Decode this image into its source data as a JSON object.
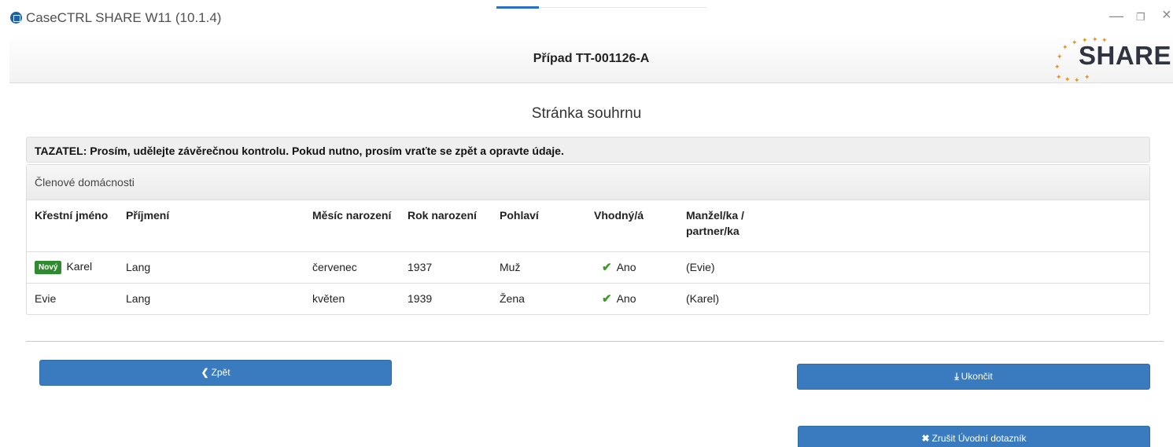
{
  "window": {
    "title": "CaseCTRL SHARE W11 (10.1.4)",
    "minimize_glyph": "—",
    "restore_glyph": "❐",
    "close_glyph": "×"
  },
  "header": {
    "case_title": "Případ TT-001126-A",
    "logo_text": "SHARE"
  },
  "page": {
    "title": "Stránka souhrnu",
    "notice": "TAZATEL: Prosím, udělejte závěrečnou kontrolu. Pokud nutno, prosím vraťte se zpět a opravte údaje."
  },
  "household": {
    "heading": "Členové domácnosti",
    "columns": [
      "Křestní jméno",
      "Příjmení",
      "Měsíc narození",
      "Rok narození",
      "Pohlaví",
      "Vhodný/á",
      "Manžel/ka / partner/ka"
    ],
    "rows": [
      {
        "badge": "Nový",
        "first_name": "Karel",
        "last_name": "Lang",
        "birth_month": "červenec",
        "birth_year": "1937",
        "sex": "Muž",
        "eligible": "Ano",
        "partner": "(Evie)"
      },
      {
        "badge": "",
        "first_name": "Evie",
        "last_name": "Lang",
        "birth_month": "květen",
        "birth_year": "1939",
        "sex": "Žena",
        "eligible": "Ano",
        "partner": "(Karel)"
      }
    ]
  },
  "buttons": {
    "back": "Zpět",
    "finish": "Ukončit",
    "cancel": "Zrušit Úvodní dotazník"
  },
  "icons": {
    "back": "chevron-left-icon",
    "finish": "download-icon",
    "cancel": "close-icon",
    "eligible": "checkmark-icon"
  },
  "colors": {
    "primary_button": "#3a7bbf",
    "badge_new": "#2e8b2e",
    "check": "#3c9a28",
    "logo_stars": "#e8921a"
  }
}
